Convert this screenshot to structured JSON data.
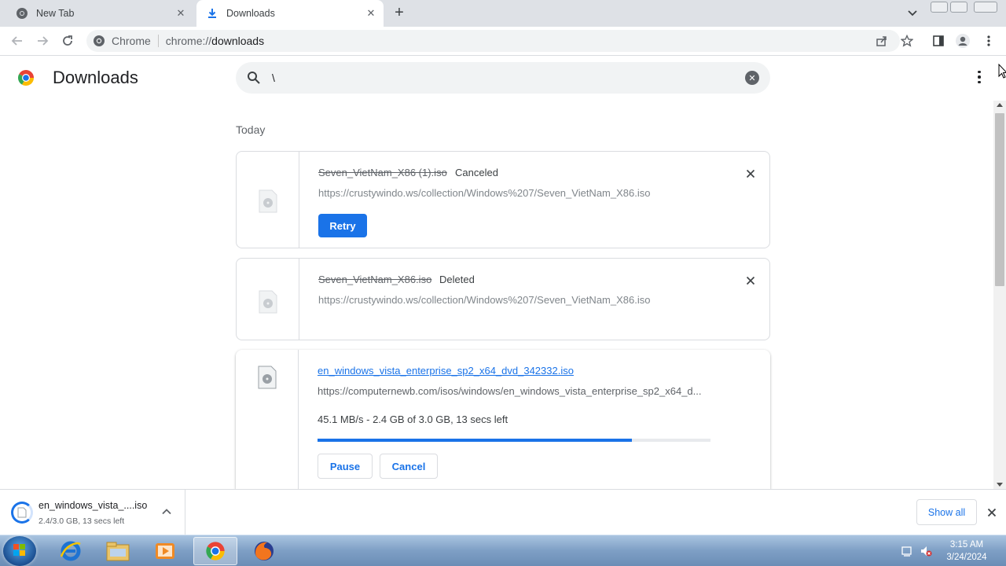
{
  "tabs": [
    {
      "title": "New Tab",
      "active": false
    },
    {
      "title": "Downloads",
      "active": true
    }
  ],
  "toolbar": {
    "site_label": "Chrome",
    "url_scheme": "chrome://",
    "url_host": "downloads"
  },
  "page": {
    "title": "Downloads",
    "search_value": "\\",
    "section_label": "Today"
  },
  "downloads": [
    {
      "filename": "Seven_VietNam_X86 (1).iso",
      "status": "Canceled",
      "url": "https://crustywindo.ws/collection/Windows%207/Seven_VietNam_X86.iso",
      "button": "Retry"
    },
    {
      "filename": "Seven_VietNam_X86.iso",
      "status": "Deleted",
      "url": "https://crustywindo.ws/collection/Windows%207/Seven_VietNam_X86.iso"
    },
    {
      "filename": "en_windows_vista_enterprise_sp2_x64_dvd_342332.iso",
      "url": "https://computernewb.com/isos/windows/en_windows_vista_enterprise_sp2_x64_d...",
      "progress_text": "45.1 MB/s - 2.4 GB of 3.0 GB, 13 secs left",
      "progress_fraction": 0.8,
      "pause_label": "Pause",
      "cancel_label": "Cancel"
    }
  ],
  "shelf": {
    "filename": "en_windows_vista_....iso",
    "status": "2.4/3.0 GB, 13 secs left",
    "show_all": "Show all"
  },
  "taskbar": {
    "time": "3:15 AM",
    "date": "3/24/2024",
    "apps": [
      "internet-explorer-icon",
      "file-explorer-icon",
      "media-player-icon",
      "chrome-icon",
      "firefox-icon"
    ]
  },
  "colors": {
    "accent": "#1a73e8",
    "tabstrip": "#dee1e6",
    "omnibox": "#f1f3f4"
  }
}
